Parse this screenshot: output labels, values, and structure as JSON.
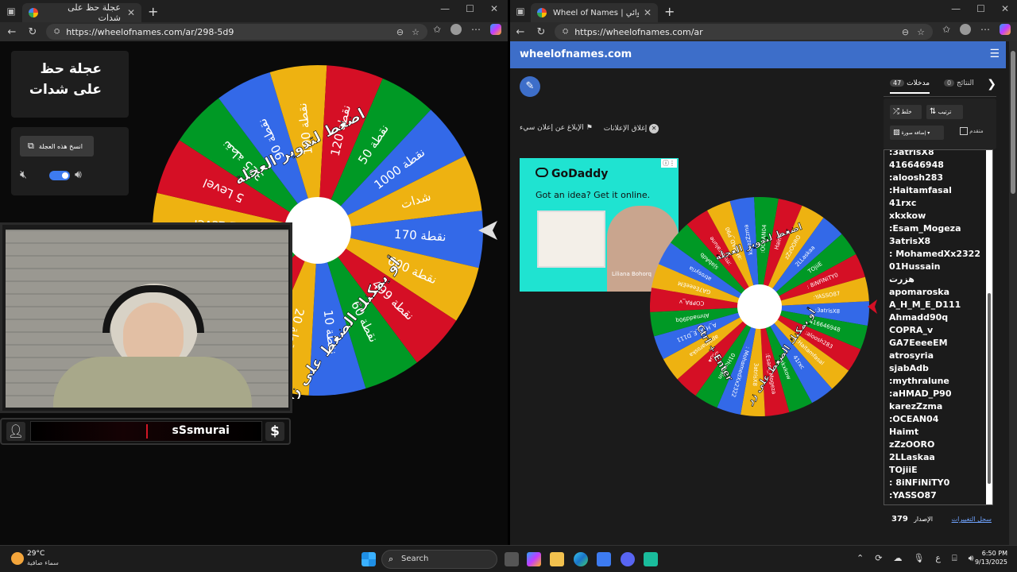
{
  "left_window": {
    "tab_title": "عجلة حظ على شدات",
    "tab_close": "✕",
    "new_tab": "+",
    "url": "https://wheelofnames.com/ar/298-5d9",
    "controls": [
      "—",
      "☐",
      "✕"
    ],
    "title_card": "عجلة حظ على شدات",
    "copy_button": "انسخ هذه العجلة",
    "wheel": {
      "segments": [
        "نقطة 170",
        "نقطة 600",
        "نقطة 499",
        "نقطة 60",
        "نقطة 10",
        "نقطة 20",
        "نقطة 50",
        "نقطة 1000",
        "500 نقطة",
        "1 Level",
        "5 Level",
        "325 نقطة",
        "نقطة 90",
        "نقطة 190",
        "نقطة 120",
        "نقطة 50",
        "نقطة 1000",
        "شدات"
      ],
      "colors": [
        "#3369e8",
        "#eeb211",
        "#d50f25",
        "#009925"
      ],
      "center_text_1": "اضغط لتدوير العجلة",
      "center_text_2": "أو يمكنك الضغط على زر"
    }
  },
  "streamer": {
    "name": "sSsmurai",
    "dollar": "$"
  },
  "right_window": {
    "tab_title": "Wheel of Names | الاسم العشوائي",
    "tab_close": "✕",
    "new_tab": "+",
    "url": "https://wheelofnames.com/ar",
    "controls": [
      "—",
      "☐",
      "✕"
    ],
    "site_name": "wheelofnames.com",
    "menu_icon": "☰",
    "report_ad": "الإبلاغ عن إعلان سيء",
    "close_ads": "إغلاق الإعلانات",
    "ad": {
      "brand": "GoDaddy",
      "headline": "Got an idea? Get it online.",
      "caption": "Liliana Bohorq"
    },
    "wheel_center_1": "اضغط لتدوير العجلة",
    "wheel_center_2": "أو يمكنك الضغط على زر",
    "wheel_center_3": "Ctrl + Enter",
    "tabs": {
      "entries_label": "مدخلات",
      "entries_count": "47",
      "results_label": "النتائج",
      "results_count": "0"
    },
    "buttons": {
      "shuffle": "خلط",
      "sort": "ترتيب",
      "add_image": "إضافة صورة",
      "advanced": "متقدم"
    },
    "entries": [
      ":3atrisX8",
      "416646948",
      ":aloosh283",
      ":Haitamfasal",
      "41rxc",
      "xkxkow",
      ":Esam_Mogeza",
      "3atrisX8",
      ": MohamedXx2322",
      "01Hussain",
      "هزرت",
      "apomaroska",
      "A_H_M_E_D111",
      "Ahmadd90q",
      "COPRA_v",
      "GA7EeeeEM",
      "atrosyria",
      "sjabAdb",
      ":mythralune",
      ":aHMAD_P90",
      "karezZzma",
      ":OCEAN04",
      "Haimt",
      "zZzOORO",
      "2LLaskaa",
      "TOjiiE",
      ": 8iNFiNiTY0",
      ":YASSO87"
    ],
    "version_label": "الإصدار",
    "version_number": "379",
    "changelog": "سجل التغييرات"
  },
  "taskbar": {
    "temperature": "29°C",
    "weather": "سماء صافية",
    "search": "Search",
    "time": "6:50 PM",
    "date": "9/13/2025",
    "lang": "ع"
  }
}
